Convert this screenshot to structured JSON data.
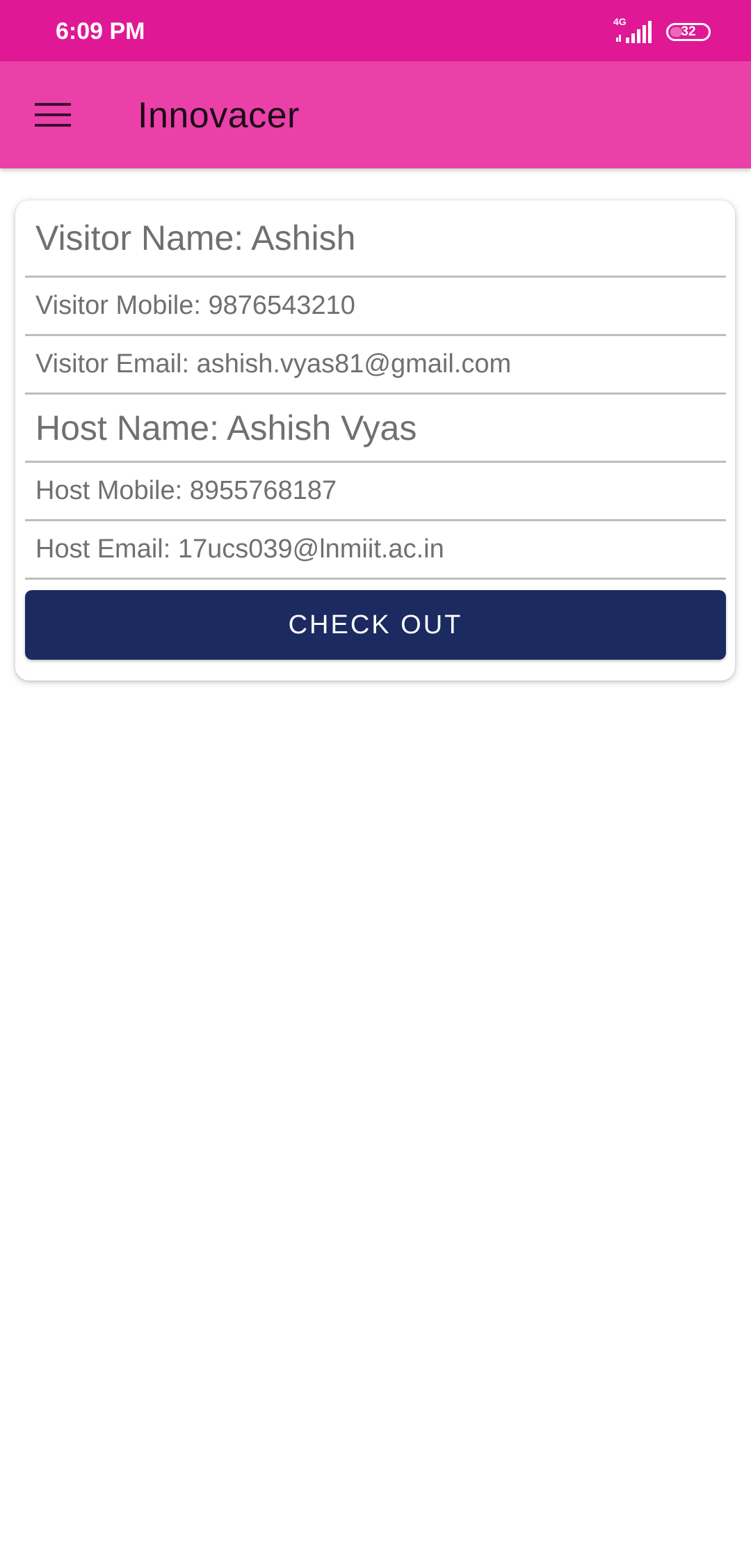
{
  "status_bar": {
    "time": "6:09 PM",
    "network_type": "4G",
    "battery_level": "32",
    "icons": [
      "signal-icon",
      "battery-icon"
    ]
  },
  "app_bar": {
    "title": "Innovacer",
    "menu_icon": "hamburger-menu-icon",
    "color": "#ec40a9"
  },
  "visit_card": {
    "visitor_name": "Visitor Name: Ashish",
    "visitor_mobile": "Visitor Mobile: 9876543210",
    "visitor_email": "Visitor Email: ashish.vyas81@gmail.com",
    "host_name": "Host Name: Ashish Vyas",
    "host_mobile": "Host Mobile: 8955768187",
    "host_email": "Host Email: 17ucs039@lnmiit.ac.in",
    "checkout_label": "CHECK OUT",
    "checkout_color": "#1b2a60"
  },
  "theme": {
    "status_bar_color": "#e01895",
    "field_text_color": "#707070",
    "divider_color": "#bdbdbd"
  }
}
